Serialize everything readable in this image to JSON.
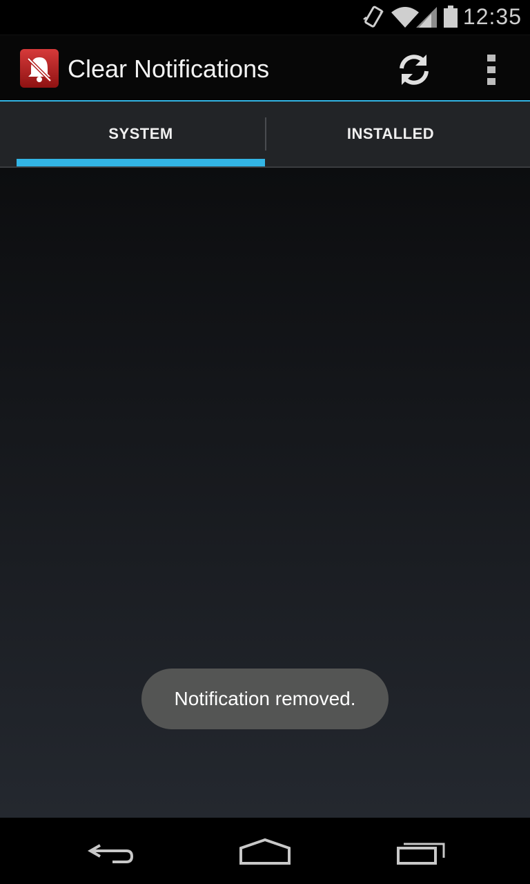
{
  "status_bar": {
    "time": "12:35",
    "icons": [
      "vibrate-icon",
      "wifi-icon",
      "signal-icon",
      "battery-icon"
    ]
  },
  "action_bar": {
    "app_title": "Clear Notifications",
    "app_icon": "bell-off-icon",
    "actions": [
      "refresh-icon",
      "overflow-menu-icon"
    ]
  },
  "tabs": [
    {
      "label": "SYSTEM",
      "selected": true
    },
    {
      "label": "INSTALLED",
      "selected": false
    }
  ],
  "toast": {
    "message": "Notification removed."
  },
  "nav_bar": {
    "buttons": [
      "back-icon",
      "home-icon",
      "recents-icon"
    ]
  },
  "colors": {
    "accent": "#33b5e5",
    "app_icon_red": "#c62828",
    "toast_bg": "#545554"
  }
}
